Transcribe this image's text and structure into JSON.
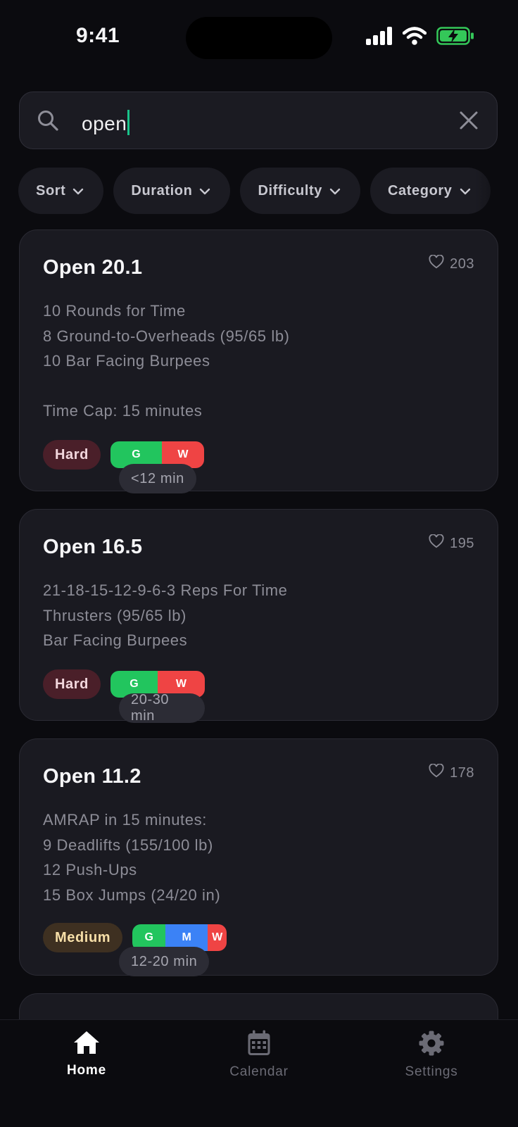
{
  "status": {
    "time": "9:41"
  },
  "search": {
    "value": "open"
  },
  "filters": [
    {
      "label": "Sort"
    },
    {
      "label": "Duration"
    },
    {
      "label": "Difficulty"
    },
    {
      "label": "Category"
    }
  ],
  "workouts": [
    {
      "title": "Open 20.1",
      "likes": "203",
      "description": "10 Rounds for Time\n8 Ground-to-Overheads (95/65 lb)\n10 Bar Facing Burpees\n\nTime Cap: 15 minutes",
      "difficulty": "Hard",
      "duration": "<12 min",
      "modalities": [
        "G",
        "W"
      ]
    },
    {
      "title": "Open 16.5",
      "likes": "195",
      "description": "21-18-15-12-9-6-3 Reps For Time\nThrusters (95/65 lb)\nBar Facing Burpees",
      "difficulty": "Hard",
      "duration": "20-30 min",
      "modalities": [
        "G",
        "W"
      ]
    },
    {
      "title": "Open 11.2",
      "likes": "178",
      "description": "AMRAP in 15 minutes:\n9 Deadlifts (155/100 lb)\n12 Push-Ups\n15 Box Jumps (24/20 in)",
      "difficulty": "Medium",
      "duration": "12-20 min",
      "modalities": [
        "G",
        "M",
        "W"
      ]
    }
  ],
  "tabs": [
    {
      "label": "Home",
      "icon": "home-icon",
      "active": true
    },
    {
      "label": "Calendar",
      "icon": "calendar-icon",
      "active": false
    },
    {
      "label": "Settings",
      "icon": "gear-icon",
      "active": false
    }
  ],
  "colors": {
    "background": "#0b0b0f",
    "card": "#1a1a21",
    "accent": "#19c38a",
    "gymnastics": "#22c55e",
    "monostructural": "#3b82f6",
    "weightlifting": "#ef4444",
    "hard": "#4a1f29",
    "medium": "#3e3021"
  }
}
